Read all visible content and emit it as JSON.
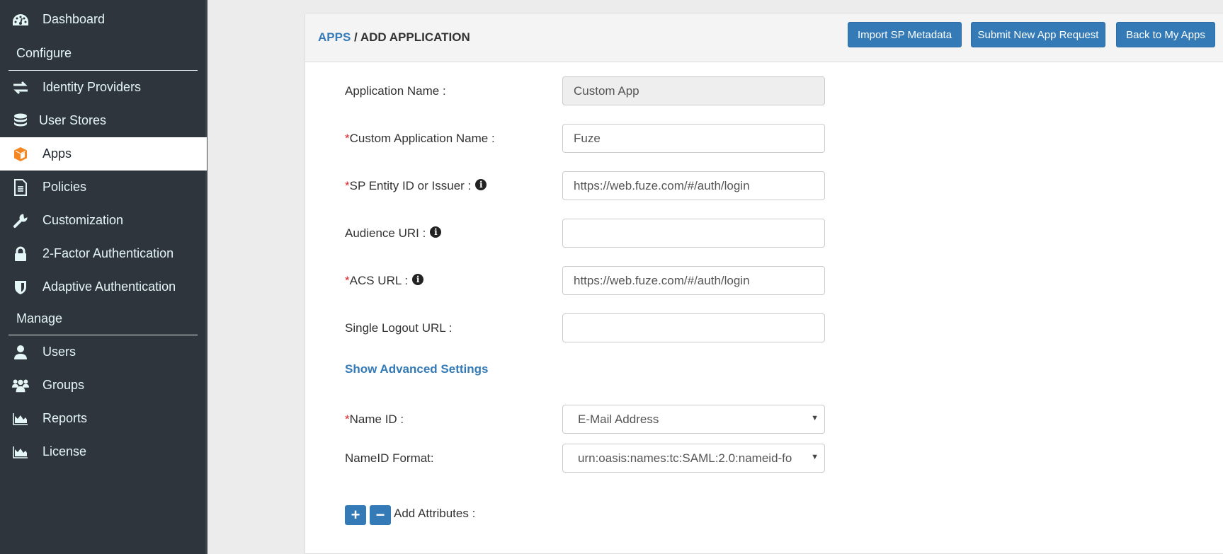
{
  "sidebar": {
    "items": [
      {
        "label": "Dashboard",
        "icon": "dashboard-icon"
      },
      {
        "label": "Identity Providers",
        "icon": "exchange-icon"
      },
      {
        "label": "User Stores",
        "icon": "database-icon"
      },
      {
        "label": "Apps",
        "icon": "cube-icon",
        "active": true
      },
      {
        "label": "Policies",
        "icon": "file-text-icon"
      },
      {
        "label": "Customization",
        "icon": "wrench-icon"
      },
      {
        "label": "2-Factor Authentication",
        "icon": "lock-icon"
      },
      {
        "label": "Adaptive Authentication",
        "icon": "shield-icon"
      },
      {
        "label": "Users",
        "icon": "user-icon"
      },
      {
        "label": "Groups",
        "icon": "users-icon"
      },
      {
        "label": "Reports",
        "icon": "area-chart-icon"
      },
      {
        "label": "License",
        "icon": "area-chart-icon"
      }
    ],
    "sections": {
      "configure": "Configure",
      "manage": "Manage"
    }
  },
  "header": {
    "breadcrumb_link": "APPS",
    "breadcrumb_sep": " / ",
    "breadcrumb_current": "ADD APPLICATION",
    "buttons": {
      "import": "Import SP Metadata",
      "submit": "Submit New App Request",
      "back": "Back to My Apps"
    }
  },
  "form": {
    "required_mark": "*",
    "fields": {
      "app_name": {
        "label": "Application Name :",
        "value": "Custom App"
      },
      "custom_name": {
        "label": "Custom Application Name :",
        "value": "Fuze"
      },
      "sp_entity": {
        "label": "SP Entity ID or Issuer :",
        "value": "https://web.fuze.com/#/auth/login"
      },
      "audience": {
        "label": "Audience URI :",
        "value": ""
      },
      "acs": {
        "label": "ACS URL :",
        "value": "https://web.fuze.com/#/auth/login"
      },
      "slo": {
        "label": "Single Logout URL :",
        "value": ""
      },
      "name_id": {
        "label": "Name ID :",
        "value": "E-Mail Address"
      },
      "name_id_format": {
        "label": "NameID Format:",
        "value": "urn:oasis:names:tc:SAML:2.0:nameid-fo"
      }
    },
    "advanced_link": "Show Advanced Settings",
    "add_attributes_label": "Add Attributes :",
    "info_glyph": "i",
    "plus_glyph": "+",
    "minus_glyph": "−",
    "caret_glyph": "▼"
  },
  "colors": {
    "accent": "#337ab7",
    "sidebar_bg": "#2f353d",
    "active_icon": "#f6861f",
    "required": "#e0262c"
  }
}
